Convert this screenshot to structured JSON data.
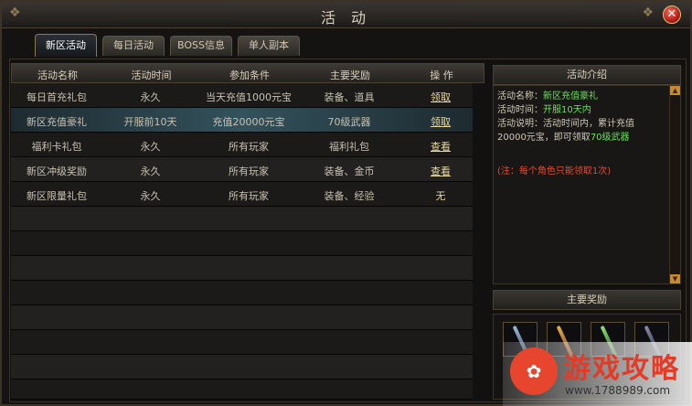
{
  "window": {
    "title": "活 动"
  },
  "tabs": [
    {
      "label": "新区活动"
    },
    {
      "label": "每日活动"
    },
    {
      "label": "BOSS信息"
    },
    {
      "label": "单人副本"
    }
  ],
  "table": {
    "headers": [
      "活动名称",
      "活动时间",
      "参加条件",
      "主要奖励",
      "操  作"
    ],
    "rows": [
      {
        "name": "每日首充礼包",
        "time": "永久",
        "condition": "当天充值1000元宝",
        "reward": "装备、道具",
        "action": "领取"
      },
      {
        "name": "新区充值豪礼",
        "time": "开服前10天",
        "condition": "充值20000元宝",
        "reward": "70级武器",
        "action": "领取"
      },
      {
        "name": "福利卡礼包",
        "time": "永久",
        "condition": "所有玩家",
        "reward": "福利礼包",
        "action": "查看"
      },
      {
        "name": "新区冲级奖励",
        "time": "永久",
        "condition": "所有玩家",
        "reward": "装备、金币",
        "action": "查看"
      },
      {
        "name": "新区限量礼包",
        "time": "永久",
        "condition": "所有玩家",
        "reward": "装备、经验",
        "action": "无"
      }
    ]
  },
  "intro": {
    "header": "活动介绍",
    "name_label": "活动名称：",
    "name_value": "新区充值豪礼",
    "time_label": "活动时间：",
    "time_value": "开服10天内",
    "desc_label": "活动说明：活动时间内，累计充值",
    "desc_line2": "20000元宝，即可领取",
    "desc_value": "70级武器",
    "note": "(注：每个角色只能领取1次)"
  },
  "rewards": {
    "header": "主要奖励"
  },
  "watermark": {
    "logo": "✿",
    "text": "游戏攻略",
    "url": "www.1788989.com"
  },
  "colors": {
    "highlight": "#6be05a",
    "note": "#e24b32",
    "accent": "#e8d9a0"
  }
}
